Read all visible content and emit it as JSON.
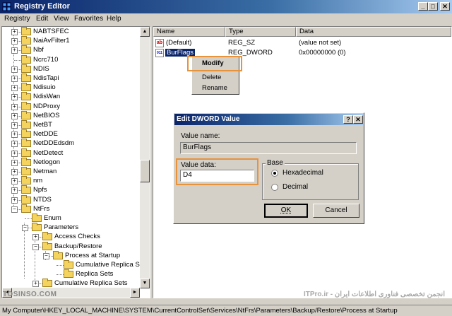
{
  "window": {
    "title": "Registry Editor",
    "controls": {
      "minimize": "_",
      "maximize": "□",
      "close": "✕"
    }
  },
  "menu": [
    "Registry",
    "Edit",
    "View",
    "Favorites",
    "Help"
  ],
  "tree": [
    {
      "label": "NABTSFEC",
      "expander": "+"
    },
    {
      "label": "NaiAvFilter1",
      "expander": "+"
    },
    {
      "label": "Nbf",
      "expander": "+"
    },
    {
      "label": "Ncrc710",
      "expander": ""
    },
    {
      "label": "NDIS",
      "expander": "+"
    },
    {
      "label": "NdisTapi",
      "expander": "+"
    },
    {
      "label": "Ndisuio",
      "expander": "+"
    },
    {
      "label": "NdisWan",
      "expander": "+"
    },
    {
      "label": "NDProxy",
      "expander": "+"
    },
    {
      "label": "NetBIOS",
      "expander": "+"
    },
    {
      "label": "NetBT",
      "expander": "+"
    },
    {
      "label": "NetDDE",
      "expander": "+"
    },
    {
      "label": "NetDDEdsdm",
      "expander": "+"
    },
    {
      "label": "NetDetect",
      "expander": "+"
    },
    {
      "label": "Netlogon",
      "expander": "+"
    },
    {
      "label": "Netman",
      "expander": "+"
    },
    {
      "label": "nm",
      "expander": "+"
    },
    {
      "label": "Npfs",
      "expander": "+"
    },
    {
      "label": "NTDS",
      "expander": "+"
    },
    {
      "label": "NtFrs",
      "expander": "−"
    },
    {
      "label": "Enum",
      "expander": ""
    },
    {
      "label": "Parameters",
      "expander": "−"
    },
    {
      "label": "Access Checks",
      "expander": "+"
    },
    {
      "label": "Backup/Restore",
      "expander": "−"
    },
    {
      "label": "Process at Startup",
      "expander": "−"
    },
    {
      "label": "Cumulative Replica Set",
      "expander": ""
    },
    {
      "label": "Replica Sets",
      "expander": ""
    },
    {
      "label": "Cumulative Replica Sets",
      "expander": "+"
    }
  ],
  "list": {
    "columns": [
      "Name",
      "Type",
      "Data"
    ],
    "rows": [
      {
        "icon": "ab",
        "name": "(Default)",
        "type": "REG_SZ",
        "data": "(value not set)"
      },
      {
        "icon": "011",
        "name": "BurFlags",
        "type": "REG_DWORD",
        "data": "0x00000000 (0)"
      }
    ]
  },
  "context_menu": {
    "items": [
      "Modify",
      "Delete",
      "Rename"
    ]
  },
  "dialog": {
    "title": "Edit DWORD Value",
    "help": "?",
    "close": "✕",
    "value_name_label": "Value name:",
    "value_name": "BurFlags",
    "value_data_label": "Value data:",
    "value_data": "D4",
    "base_label": "Base",
    "hex_label": "Hexadecimal",
    "dec_label": "Decimal",
    "selected_base": "Hexadecimal",
    "ok": "OK",
    "cancel": "Cancel"
  },
  "scroll": {
    "up": "▲",
    "down": "▼",
    "left": "◄",
    "right": "►"
  },
  "statusbar": "My Computer\\HKEY_LOCAL_MACHINE\\SYSTEM\\CurrentControlSet\\Services\\NtFrs\\Parameters\\Backup/Restore\\Process at Startup",
  "watermark": {
    "left": "TOSINSO.COM",
    "right": "ITPro.ir - انجمن تخصصی فناوری اطلاعات ایران"
  },
  "colors": {
    "highlight_outline": "#e8923a",
    "title_bar": "#0a246a",
    "selection": "#0a246a"
  }
}
